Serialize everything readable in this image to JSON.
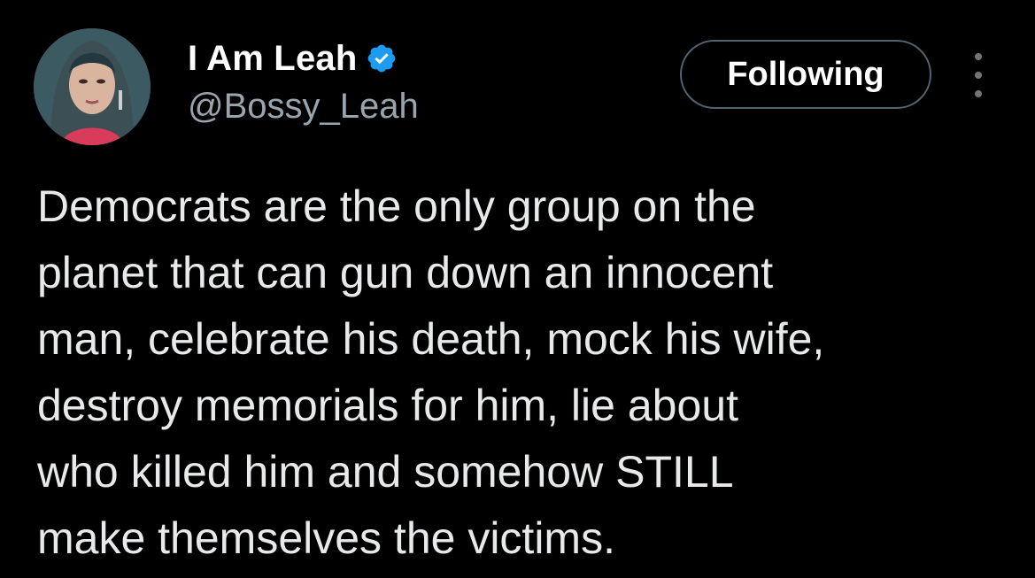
{
  "author": {
    "display_name": "I Am Leah",
    "handle": "@Bossy_Leah",
    "verified_icon": "verified-badge-icon",
    "avatar": "profile-photo"
  },
  "actions": {
    "follow_label": "Following",
    "more_icon": "more-options-icon"
  },
  "tweet": {
    "lines": [
      "Democrats are the only group on the",
      "planet that can gun down an innocent",
      "man, celebrate his death, mock his wife,",
      "destroy memorials for him, lie about",
      "who killed him and somehow STILL",
      "make themselves the victims."
    ]
  },
  "colors": {
    "background": "#000000",
    "text": "#e7e9ea",
    "secondary_text": "#9aa4ad",
    "verified_blue": "#1d9bf0",
    "button_border": "#536471"
  }
}
